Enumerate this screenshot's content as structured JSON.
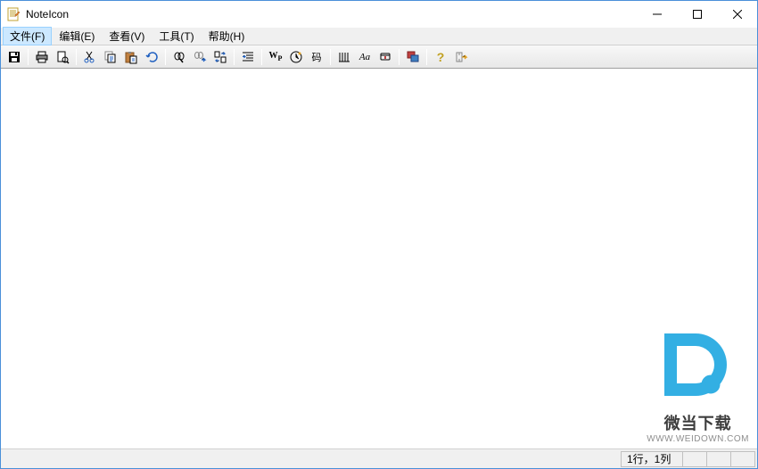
{
  "window": {
    "title": "NoteIcon"
  },
  "menu": {
    "file": "文件(F)",
    "edit": "编辑(E)",
    "view": "查看(V)",
    "tool": "工具(T)",
    "help": "帮助(H)"
  },
  "toolbar": {
    "save": "save",
    "print": "print",
    "preview": "preview",
    "cut": "cut",
    "copy": "copy",
    "paste": "paste",
    "undo": "undo",
    "find": "find",
    "findnext": "findnext",
    "replace": "replace",
    "indent": "indent",
    "wordwrap": "Wp",
    "time": "time",
    "encoding": "码",
    "width": "width",
    "font": "Aa",
    "bookmark": "bookmark",
    "windows": "windows",
    "help": "?",
    "exit": "exit"
  },
  "status": {
    "position": "1行，1列"
  },
  "watermark": {
    "text": "微当下载",
    "url": "WWW.WEIDOWN.COM"
  }
}
